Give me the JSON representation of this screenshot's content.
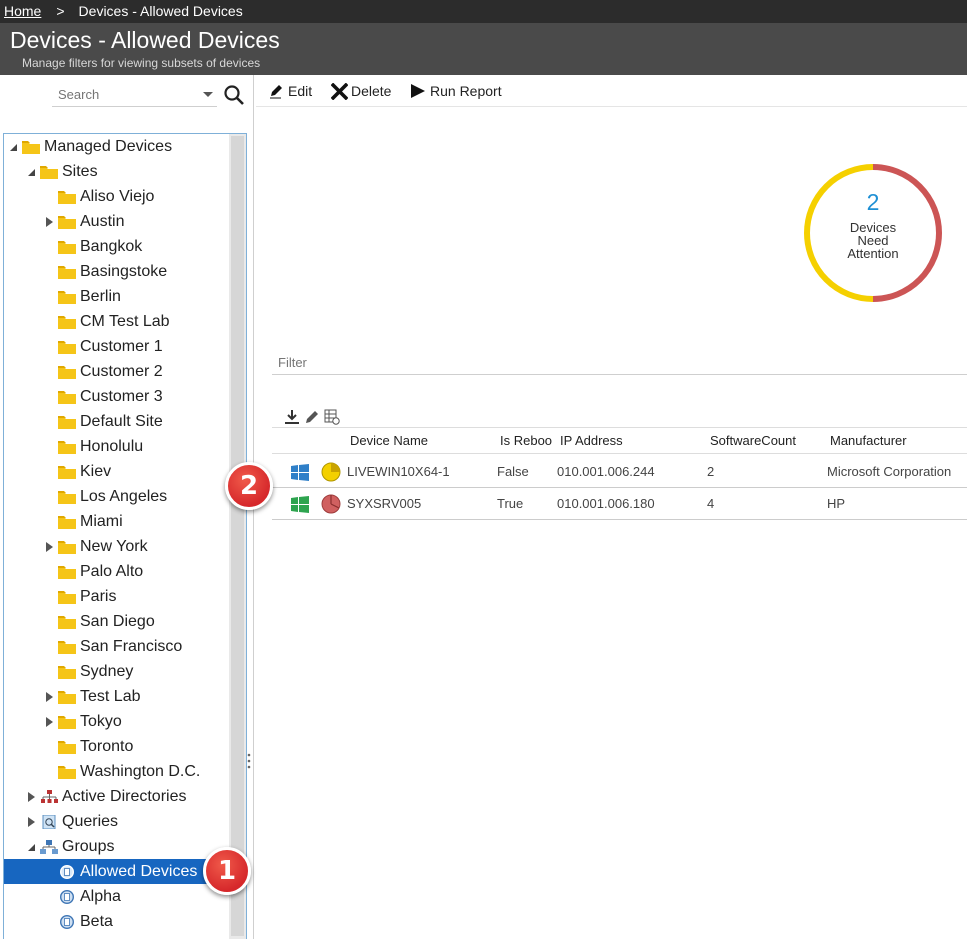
{
  "breadcrumb": {
    "home": "Home",
    "separator": ">",
    "current": "Devices - Allowed Devices"
  },
  "header": {
    "title": "Devices - Allowed Devices",
    "subtitle": "Manage filters for viewing subsets of devices"
  },
  "search": {
    "placeholder": "Search",
    "icon": "search-icon"
  },
  "tree": {
    "root": "Managed Devices",
    "sites_label": "Sites",
    "sites": [
      {
        "label": "Aliso Viejo",
        "expandable": false
      },
      {
        "label": "Austin",
        "expandable": true
      },
      {
        "label": "Bangkok",
        "expandable": false
      },
      {
        "label": "Basingstoke",
        "expandable": false
      },
      {
        "label": "Berlin",
        "expandable": false
      },
      {
        "label": "CM Test Lab",
        "expandable": false
      },
      {
        "label": "Customer 1",
        "expandable": false
      },
      {
        "label": "Customer 2",
        "expandable": false
      },
      {
        "label": "Customer 3",
        "expandable": false
      },
      {
        "label": "Default Site",
        "expandable": false
      },
      {
        "label": "Honolulu",
        "expandable": false
      },
      {
        "label": "Kiev",
        "expandable": false
      },
      {
        "label": "Los Angeles",
        "expandable": false
      },
      {
        "label": "Miami",
        "expandable": false
      },
      {
        "label": "New York",
        "expandable": true
      },
      {
        "label": "Palo Alto",
        "expandable": false
      },
      {
        "label": "Paris",
        "expandable": false
      },
      {
        "label": "San Diego",
        "expandable": false
      },
      {
        "label": "San Francisco",
        "expandable": false
      },
      {
        "label": "Sydney",
        "expandable": false
      },
      {
        "label": "Test Lab",
        "expandable": true
      },
      {
        "label": "Tokyo",
        "expandable": true
      },
      {
        "label": "Toronto",
        "expandable": false
      },
      {
        "label": "Washington D.C.",
        "expandable": false
      }
    ],
    "active_directories": "Active Directories",
    "queries": "Queries",
    "groups_label": "Groups",
    "groups": [
      {
        "label": "Allowed Devices",
        "selected": true
      },
      {
        "label": "Alpha",
        "selected": false
      },
      {
        "label": "Beta",
        "selected": false
      }
    ]
  },
  "toolbar": {
    "edit": "Edit",
    "delete": "Delete",
    "run_report": "Run Report"
  },
  "attention": {
    "count": "2",
    "line1": "Devices",
    "line2": "Need",
    "line3": "Attention",
    "segments": [
      {
        "color": "#cc5555",
        "fraction": 0.5
      },
      {
        "color": "#f5d000",
        "fraction": 0.5
      }
    ]
  },
  "filter": {
    "placeholder": "Filter"
  },
  "grid": {
    "columns": [
      "Device Name",
      "Is Reboo",
      "IP Address",
      "SoftwareCount",
      "Manufacturer"
    ],
    "rows": [
      {
        "os": "windows-blue",
        "status": "pie-yellow",
        "name": "LIVEWIN10X64-1",
        "reboot": "False",
        "ip": "010.001.006.244",
        "software": "2",
        "manufacturer": "Microsoft Corporation"
      },
      {
        "os": "windows-green",
        "status": "pie-red",
        "name": "SYXSRV005",
        "reboot": "True",
        "ip": "010.001.006.180",
        "software": "4",
        "manufacturer": "HP"
      }
    ]
  },
  "callouts": [
    "1",
    "2"
  ],
  "colors": {
    "selected": "#1766c0",
    "header": "#4a4a4a",
    "crumbbar": "#2c2c2c",
    "folder": "#f5c518",
    "callout": "#d6282b",
    "accent": "#1e8fd4"
  }
}
